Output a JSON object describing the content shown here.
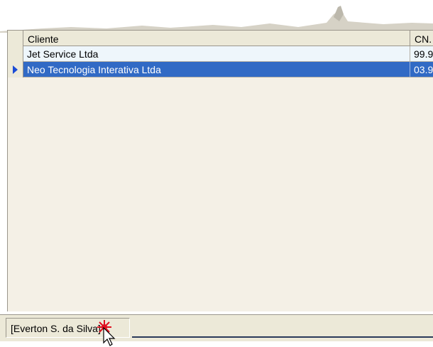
{
  "grid": {
    "columns": [
      "Cliente",
      "CN."
    ],
    "rows": [
      {
        "cliente": "Jet Service Ltda",
        "cnpj": "99.9",
        "selected": false
      },
      {
        "cliente": "Neo Tecnologia Interativa Ltda",
        "cnpj": "03.9",
        "selected": true
      }
    ]
  },
  "status_bar": {
    "user": "[Everton S. da Silva]"
  },
  "colors": {
    "selection": "#316ac5",
    "grid_background": "#f4f0e6",
    "row_background": "#eef6fb",
    "click_marker": "#e01020"
  }
}
